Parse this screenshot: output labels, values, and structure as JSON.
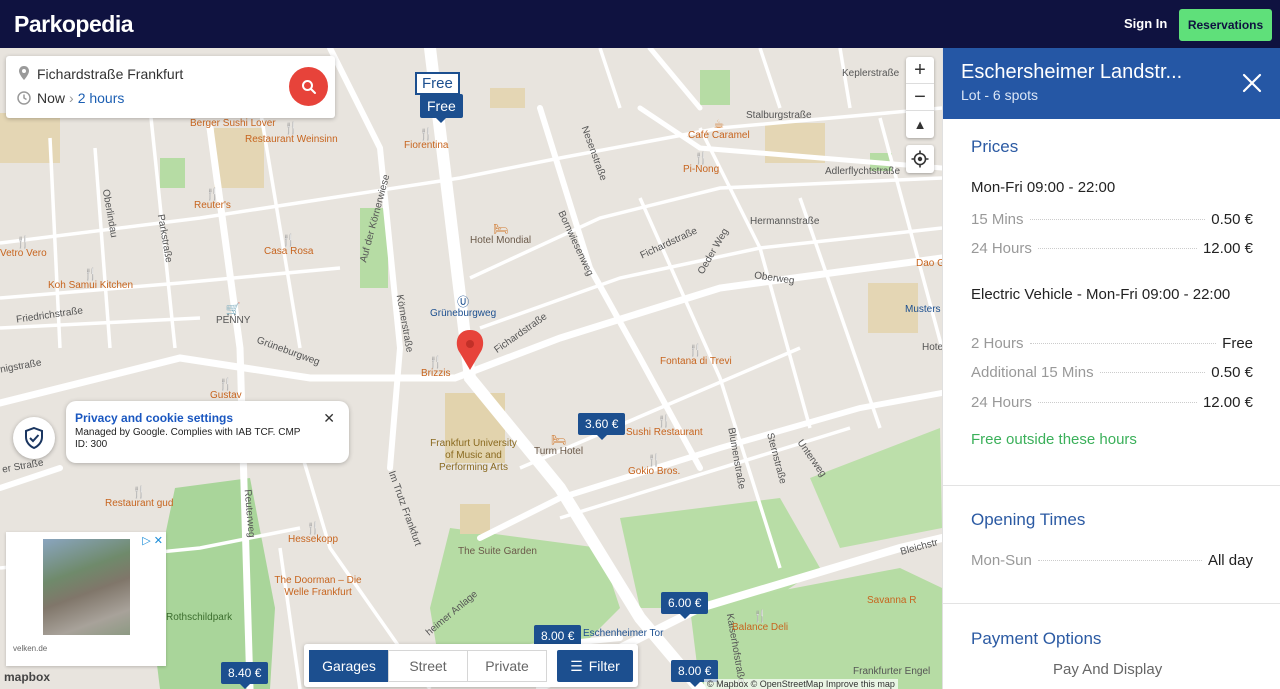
{
  "header": {
    "logo": "Parkopedia",
    "signin": "Sign In",
    "reservations": "Reservations"
  },
  "search": {
    "location": "Fichardstraße Frankfurt",
    "time_start": "Now",
    "duration": "2 hours"
  },
  "map": {
    "free_label": "Free",
    "free_pin": "Free",
    "prices": [
      "3.60 €",
      "6.00 €",
      "8.00 €",
      "8.40 €",
      "8.00 €"
    ],
    "streets": [
      "Keplerstraße",
      "Stalburgstraße",
      "Adlerflychtstraße",
      "Hermannstraße",
      "Oberweg",
      "Oeder Weg",
      "Fichardstraße",
      "Nesenstraße",
      "Bornwiesenweg",
      "Grüneburgweg",
      "Körnerstraße",
      "Auf der Körnerwiese",
      "Oberlindau",
      "Parkstraße",
      "Friedrichstraße",
      "nigstraße",
      "Fichardstraße",
      "Blumenstraße",
      "Sternstraße",
      "Unterweg",
      "Reuterweg",
      "Im Trutz Frankfurt",
      "heimer Anlage",
      "Kaiserhofstraße",
      "Bleichstr",
      "er Straße",
      "Musters",
      "Hote"
    ],
    "pois": [
      "Berger Sushi Lover",
      "Restaurant Weinsinn",
      "Fiorentina",
      "Café Caramel",
      "Pi-Nong",
      "Reuter's",
      "Hotel Mondial",
      "Vetro Vero",
      "Casa Rosa",
      "Koh Samui Kitchen",
      "PENNY",
      "Grüneburgweg",
      "Brizzis",
      "Fontana di Trevi",
      "Gustav",
      "Frankfurt University of Music and Performing Arts",
      "Turm Hotel",
      "Sushi Restaurant",
      "Gokio Bros.",
      "Restaurant gud",
      "Hessekopp",
      "The Suite Garden",
      "The Doorman – Die Welle Frankfurt",
      "Rothschildpark",
      "Eschenheimer Tor",
      "Balance Deli",
      "Savanna R",
      "Frankfurter Engel",
      "Dao G"
    ],
    "mapbox": "mapbox",
    "attribution": "© Mapbox © OpenStreetMap  Improve this map"
  },
  "privacy": {
    "title": "Privacy and cookie settings",
    "body": "Managed by Google. Complies with IAB TCF. CMP ID: 300"
  },
  "ad": {
    "source": "velken.de"
  },
  "filterbar": {
    "tabs": [
      "Garages",
      "Street",
      "Private"
    ],
    "active_tab": "Garages",
    "filter": "Filter"
  },
  "panel": {
    "title": "Eschersheimer Landstr...",
    "subtitle": "Lot - 6 spots",
    "prices_title": "Prices",
    "period1": "Mon-Fri 09:00 - 22:00",
    "period1_rows": [
      {
        "k": "15 Mins",
        "v": "0.50 €"
      },
      {
        "k": "24 Hours",
        "v": "12.00 €"
      }
    ],
    "period2": "Electric Vehicle - Mon-Fri 09:00 - 22:00",
    "period2_rows": [
      {
        "k": "2 Hours",
        "v": "Free"
      },
      {
        "k": "Additional 15 Mins",
        "v": "0.50 €"
      },
      {
        "k": "24 Hours",
        "v": "12.00 €"
      }
    ],
    "free_outside": "Free outside these hours",
    "opening_title": "Opening Times",
    "opening_rows": [
      {
        "k": "Mon-Sun",
        "v": "All day"
      }
    ],
    "payment_title": "Payment Options",
    "payment": "Pay And Display"
  },
  "colors": {
    "header_bg": "#0f1240",
    "reservations_bg": "#5fe07a",
    "brand_blue": "#2557a5",
    "price_pin": "#1c4f8f",
    "marker": "#e7433a",
    "free_text": "#3bb05a"
  }
}
